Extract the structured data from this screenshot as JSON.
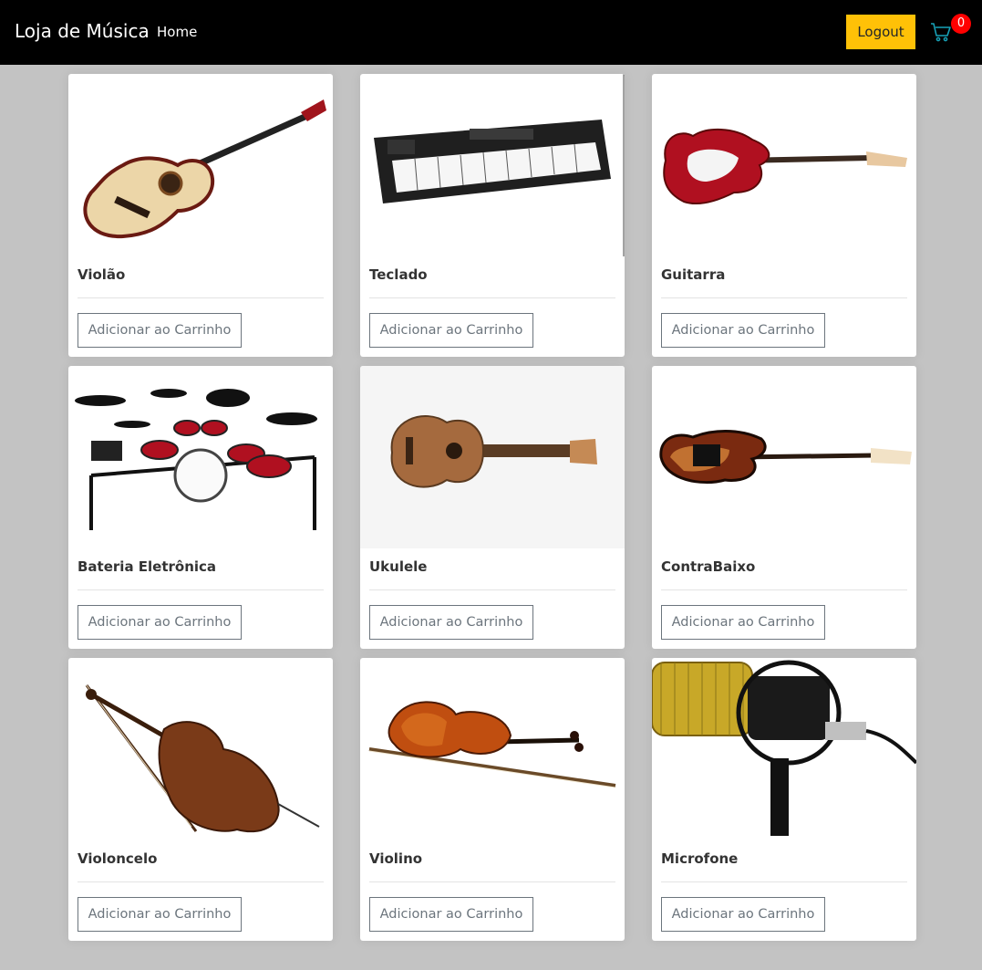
{
  "navbar": {
    "brand": "Loja de Música",
    "home_label": "Home",
    "logout_label": "Logout",
    "cart_icon": "cart-icon",
    "cart_count": "0"
  },
  "products": [
    {
      "name": "Violão",
      "image": "acoustic-guitar",
      "button_label": "Adicionar ao Carrinho"
    },
    {
      "name": "Teclado",
      "image": "keyboard",
      "button_label": "Adicionar ao Carrinho"
    },
    {
      "name": "Guitarra",
      "image": "electric-guitar",
      "button_label": "Adicionar ao Carrinho"
    },
    {
      "name": "Bateria Eletrônica",
      "image": "electronic-drum-kit",
      "button_label": "Adicionar ao Carrinho"
    },
    {
      "name": "Ukulele",
      "image": "ukulele",
      "button_label": "Adicionar ao Carrinho"
    },
    {
      "name": "ContraBaixo",
      "image": "bass-guitar",
      "button_label": "Adicionar ao Carrinho"
    },
    {
      "name": "Violoncelo",
      "image": "cello",
      "button_label": "Adicionar ao Carrinho"
    },
    {
      "name": "Violino",
      "image": "violin",
      "button_label": "Adicionar ao Carrinho"
    },
    {
      "name": "Microfone",
      "image": "microphone",
      "button_label": "Adicionar ao Carrinho"
    }
  ],
  "colors": {
    "navbar_bg": "#000000",
    "page_bg": "#c3c3c3",
    "logout_bg": "#ffc107",
    "badge_bg": "#ff0000",
    "cart_icon": "#17a2b8",
    "button_border": "#6c757d"
  }
}
